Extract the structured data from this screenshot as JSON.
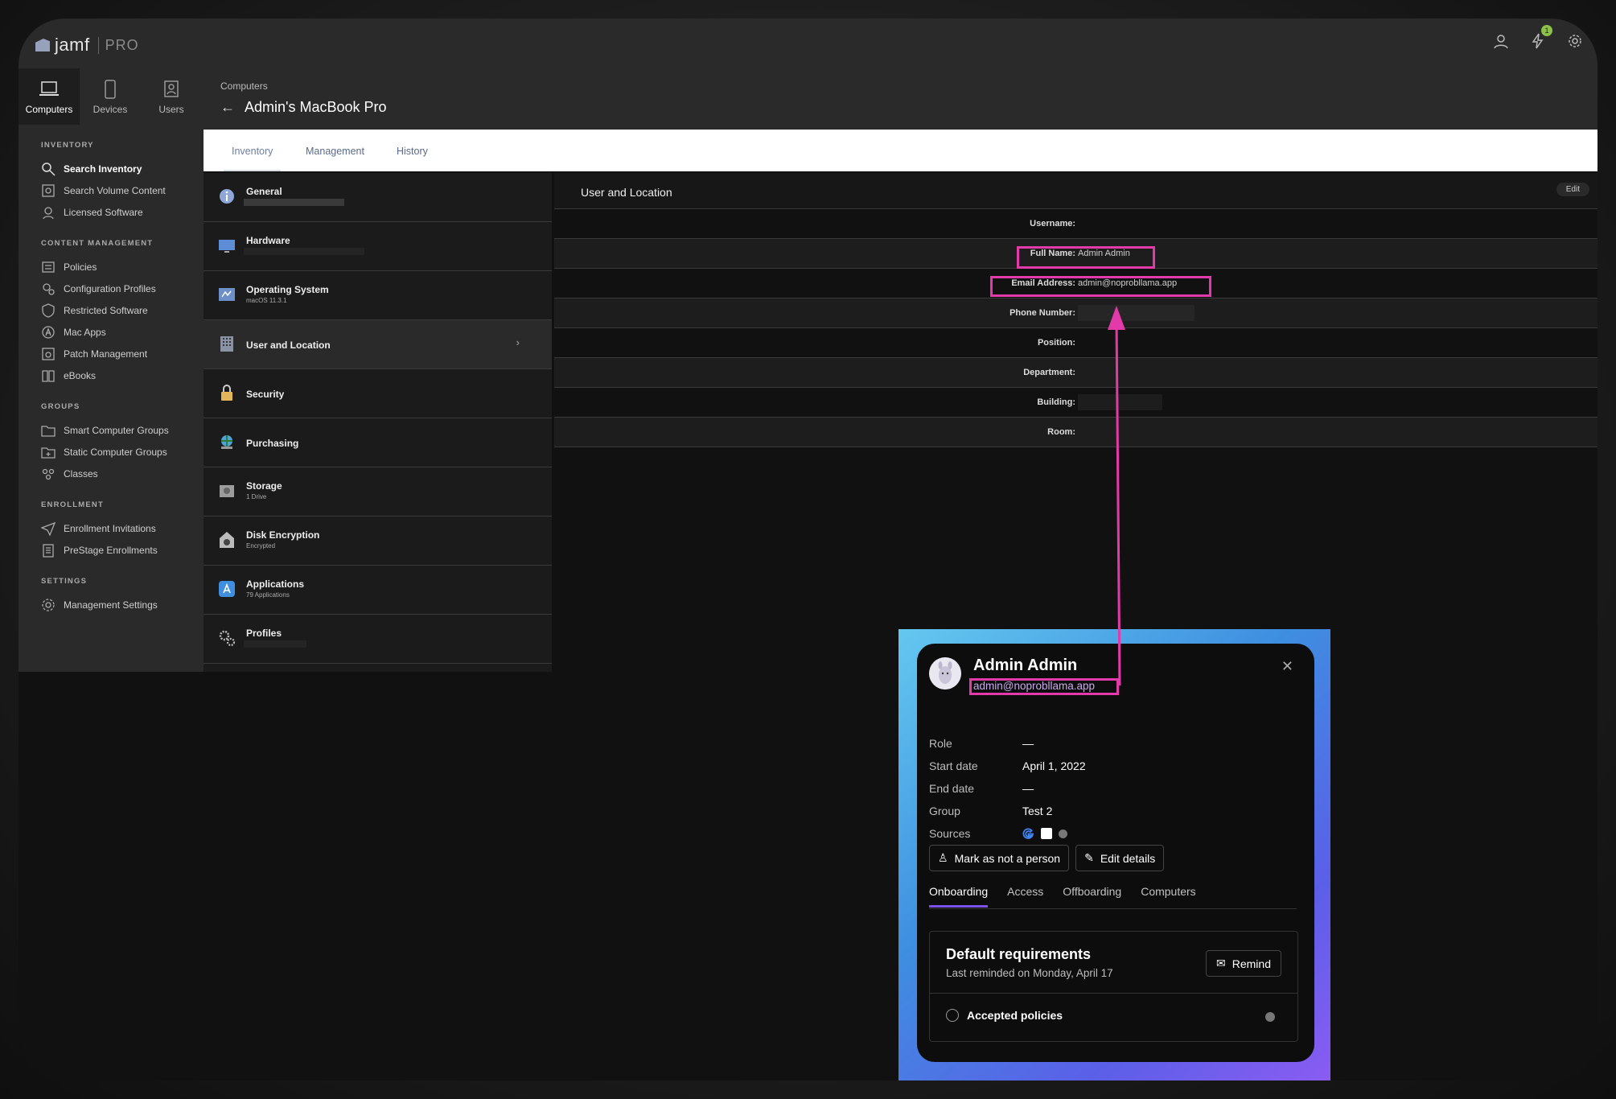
{
  "app": {
    "logo_text": "jamf",
    "logo_suffix": "PRO",
    "notification_count": "1"
  },
  "nav_tabs": [
    {
      "label": "Computers",
      "icon": "laptop-icon"
    },
    {
      "label": "Devices",
      "icon": "phone-icon"
    },
    {
      "label": "Users",
      "icon": "users-icon"
    }
  ],
  "sidebar": {
    "inventory_heading": "INVENTORY",
    "inventory": [
      "Search Inventory",
      "Search Volume Content",
      "Licensed Software"
    ],
    "content_heading": "CONTENT MANAGEMENT",
    "content": [
      "Policies",
      "Configuration Profiles",
      "Restricted Software",
      "Mac Apps",
      "Patch Management",
      "eBooks"
    ],
    "groups_heading": "GROUPS",
    "groups": [
      "Smart Computer Groups",
      "Static Computer Groups",
      "Classes"
    ],
    "enrollment_heading": "ENROLLMENT",
    "enrollment": [
      "Enrollment Invitations",
      "PreStage Enrollments"
    ],
    "settings_heading": "SETTINGS",
    "settings": [
      "Management Settings"
    ]
  },
  "header": {
    "breadcrumb": "Computers",
    "back": "←",
    "title": "Admin's MacBook Pro"
  },
  "tabs": [
    "Inventory",
    "Management",
    "History"
  ],
  "categories": [
    {
      "name": "General",
      "sub": ""
    },
    {
      "name": "Hardware",
      "sub": ""
    },
    {
      "name": "Operating System",
      "sub": "macOS 11.3.1"
    },
    {
      "name": "User and Location",
      "sub": ""
    },
    {
      "name": "Security",
      "sub": ""
    },
    {
      "name": "Purchasing",
      "sub": ""
    },
    {
      "name": "Storage",
      "sub": "1 Drive"
    },
    {
      "name": "Disk Encryption",
      "sub": "Encrypted"
    },
    {
      "name": "Applications",
      "sub": "79 Applications"
    },
    {
      "name": "Profiles",
      "sub": ""
    }
  ],
  "detail": {
    "title": "User and Location",
    "edit_label": "Edit",
    "fields": [
      {
        "label": "Username:",
        "value": ""
      },
      {
        "label": "Full Name:",
        "value": "Admin Admin"
      },
      {
        "label": "Email Address:",
        "value": "admin@noprobllama.app"
      },
      {
        "label": "Phone Number:",
        "value": ""
      },
      {
        "label": "Position:",
        "value": ""
      },
      {
        "label": "Department:",
        "value": ""
      },
      {
        "label": "Building:",
        "value": ""
      },
      {
        "label": "Room:",
        "value": ""
      }
    ]
  },
  "person": {
    "name": "Admin Admin",
    "email": "admin@noprobllama.app",
    "close": "✕",
    "attributes": [
      {
        "key": "Role",
        "value": "—"
      },
      {
        "key": "Start date",
        "value": "April 1, 2022"
      },
      {
        "key": "End date",
        "value": "—"
      },
      {
        "key": "Group",
        "value": "Test 2"
      },
      {
        "key": "Sources",
        "value": ""
      }
    ],
    "mark_button": "Mark as not a person",
    "edit_button": "Edit details",
    "tabs": [
      "Onboarding",
      "Access",
      "Offboarding",
      "Computers"
    ],
    "requirements_title": "Default requirements",
    "requirements_sub": "Last reminded on Monday, April 17",
    "remind_button": "Remind",
    "requirement_item": "Accepted policies"
  },
  "colors": {
    "highlight": "#e23ba9",
    "accent_tab": "#7a52e8",
    "badge": "#8dc04a"
  }
}
